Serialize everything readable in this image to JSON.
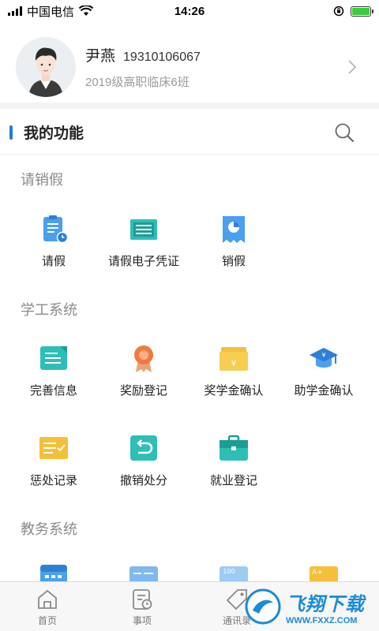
{
  "status_bar": {
    "carrier": "中国电信",
    "time": "14:26"
  },
  "profile": {
    "name": "尹燕",
    "phone": "19310106067",
    "class": "2019级高职临床6班"
  },
  "functions": {
    "title": "我的功能"
  },
  "sections": [
    {
      "title": "请销假",
      "items": [
        {
          "label": "请假",
          "icon": "leave-clipboard-icon"
        },
        {
          "label": "请假电子凭证",
          "icon": "leave-certificate-icon"
        },
        {
          "label": "销假",
          "icon": "cancel-leave-receipt-icon"
        }
      ]
    },
    {
      "title": "学工系统",
      "items": [
        {
          "label": "完善信息",
          "icon": "edit-info-icon"
        },
        {
          "label": "奖励登记",
          "icon": "award-medal-icon"
        },
        {
          "label": "奖学金确认",
          "icon": "scholarship-envelope-icon"
        },
        {
          "label": "助学金确认",
          "icon": "grant-graduation-cap-icon"
        },
        {
          "label": "惩处记录",
          "icon": "punishment-record-icon"
        },
        {
          "label": "撤销处分",
          "icon": "revoke-undo-icon"
        },
        {
          "label": "就业登记",
          "icon": "employment-briefcase-icon"
        }
      ]
    },
    {
      "title": "教务系统",
      "items": [
        {
          "label": "",
          "icon": "calendar-icon"
        },
        {
          "label": "",
          "icon": "card-icon"
        },
        {
          "label": "100",
          "icon": "score-icon"
        },
        {
          "label": "A+",
          "icon": "grade-icon"
        }
      ]
    }
  ],
  "tabbar": {
    "items": [
      {
        "label": "首页",
        "icon": "home-icon"
      },
      {
        "label": "事项",
        "icon": "tasks-clock-icon"
      },
      {
        "label": "通讯录",
        "icon": "contacts-tag-icon"
      }
    ]
  },
  "watermark": {
    "text": "飞翔下载",
    "url": "WWW.FXXZ.COM"
  },
  "colors": {
    "accent": "#1e7be6",
    "icon_blue": "#4a9ff0",
    "icon_teal": "#2dbfb6",
    "icon_orange": "#f07a3c",
    "icon_yellow": "#f5bf3a",
    "battery": "#3ccb3c"
  }
}
